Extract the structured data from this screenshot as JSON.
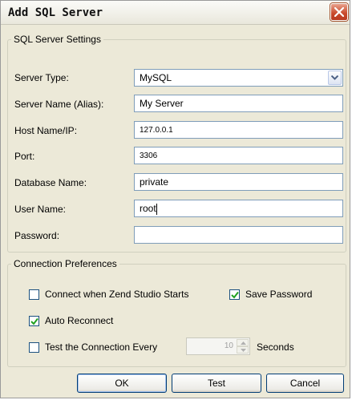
{
  "dialog": {
    "title": "Add SQL Server"
  },
  "settings": {
    "legend": "SQL Server Settings",
    "server_type": {
      "label": "Server Type:",
      "value": "MySQL"
    },
    "server_name": {
      "label": "Server Name (Alias):",
      "value": "My Server"
    },
    "host": {
      "label": "Host Name/IP:",
      "value": "127.0.0.1"
    },
    "port": {
      "label": "Port:",
      "value": "3306"
    },
    "database": {
      "label": "Database Name:",
      "value": "private"
    },
    "user": {
      "label": "User Name:",
      "value": "root"
    },
    "password": {
      "label": "Password:",
      "value": ""
    }
  },
  "prefs": {
    "legend": "Connection Preferences",
    "connect_on_start": {
      "label": "Connect when Zend Studio Starts",
      "checked": false
    },
    "save_password": {
      "label": "Save Password",
      "checked": true
    },
    "auto_reconnect": {
      "label": "Auto Reconnect",
      "checked": true
    },
    "test_every": {
      "label": "Test the Connection Every",
      "checked": false,
      "value": "10",
      "unit": "Seconds"
    }
  },
  "buttons": {
    "ok": "OK",
    "test": "Test",
    "cancel": "Cancel"
  },
  "colors": {
    "accent": "#003c74",
    "check": "#21a121",
    "close": "#c8482a"
  }
}
